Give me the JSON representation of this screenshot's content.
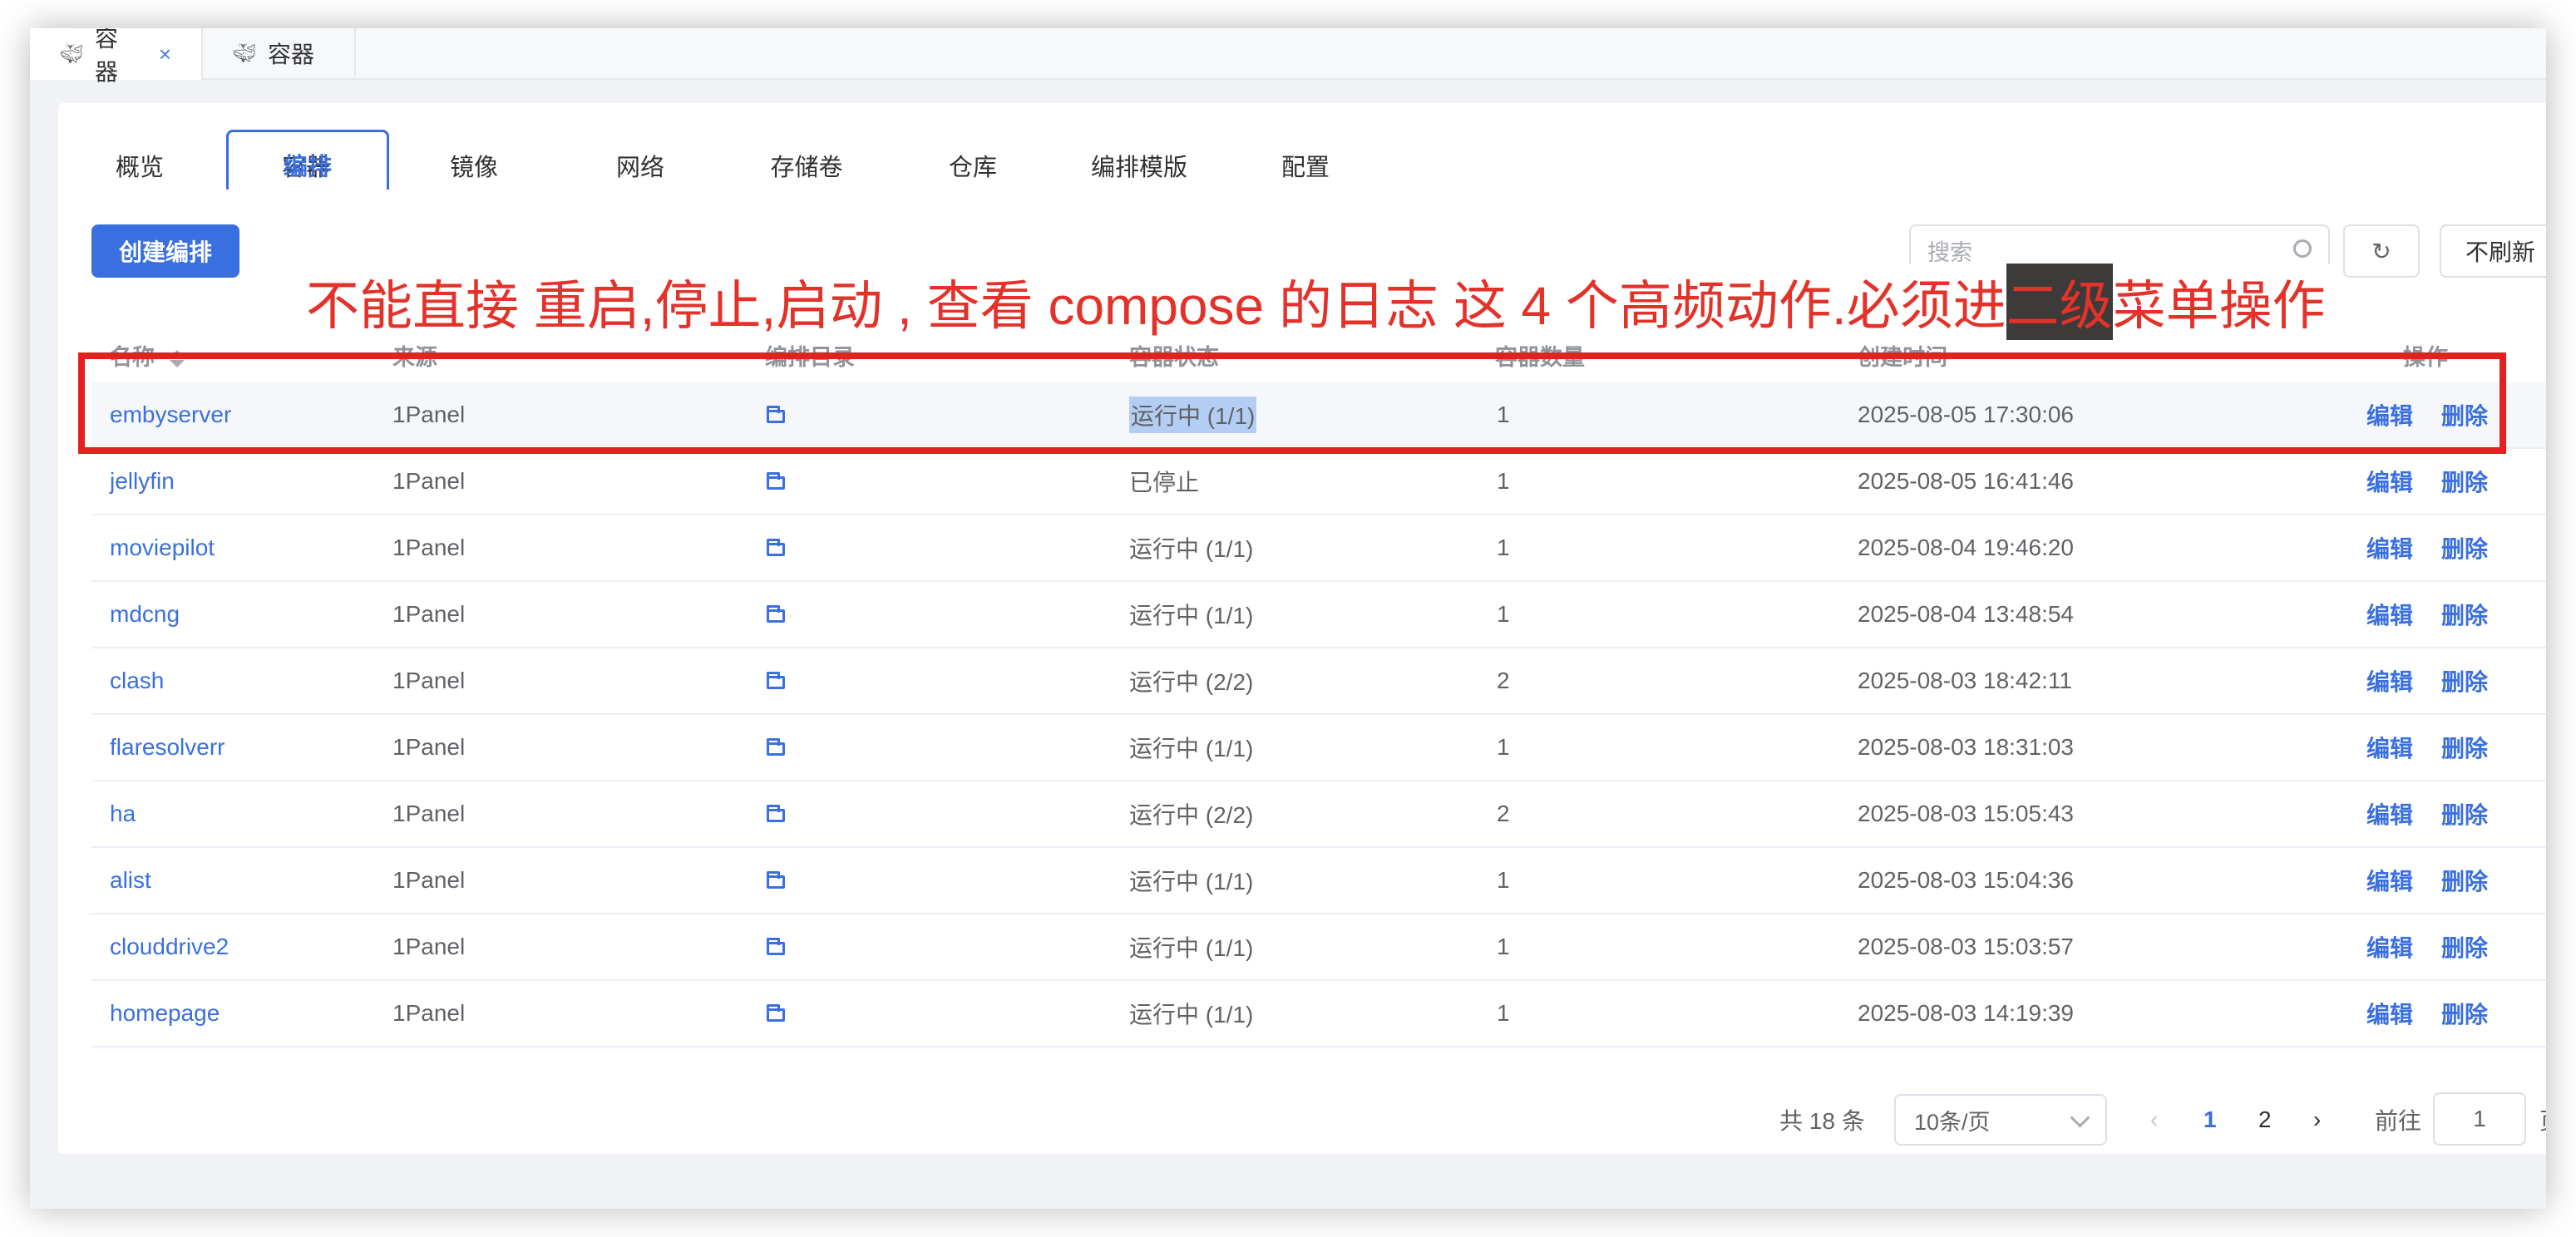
{
  "page_tabs": [
    {
      "icon": "docker-whale-icon",
      "label": "容器",
      "closable": true,
      "active": true
    },
    {
      "icon": "docker-whale-icon",
      "label": "容器",
      "closable": false,
      "active": false
    }
  ],
  "menu_tabs": [
    {
      "label": "概览",
      "active": false
    },
    {
      "label": "容器",
      "active": false
    },
    {
      "label": "编排",
      "active": true
    },
    {
      "label": "镜像",
      "active": false
    },
    {
      "label": "网络",
      "active": false
    },
    {
      "label": "存储卷",
      "active": false
    },
    {
      "label": "仓库",
      "active": false
    },
    {
      "label": "编排模版",
      "active": false
    },
    {
      "label": "配置",
      "active": false
    }
  ],
  "toolbar": {
    "create_label": "创建编排",
    "search_placeholder": "搜索",
    "refresh_icon": "refresh-icon",
    "no_refresh_label": "不刷新"
  },
  "table": {
    "columns": [
      "名称",
      "来源",
      "编排目录",
      "容器状态",
      "容器数量",
      "创建时间",
      "操作"
    ],
    "rows": [
      {
        "name": "embyserver",
        "source": "1Panel",
        "status": "运行中 (1/1)",
        "count": "1",
        "created": "2025-08-05 17:30:06"
      },
      {
        "name": "jellyfin",
        "source": "1Panel",
        "status": "已停止",
        "count": "1",
        "created": "2025-08-05 16:41:46"
      },
      {
        "name": "moviepilot",
        "source": "1Panel",
        "status": "运行中 (1/1)",
        "count": "1",
        "created": "2025-08-04 19:46:20"
      },
      {
        "name": "mdcng",
        "source": "1Panel",
        "status": "运行中 (1/1)",
        "count": "1",
        "created": "2025-08-04 13:48:54"
      },
      {
        "name": "clash",
        "source": "1Panel",
        "status": "运行中 (2/2)",
        "count": "2",
        "created": "2025-08-03 18:42:11"
      },
      {
        "name": "flaresolverr",
        "source": "1Panel",
        "status": "运行中 (1/1)",
        "count": "1",
        "created": "2025-08-03 18:31:03"
      },
      {
        "name": "ha",
        "source": "1Panel",
        "status": "运行中 (2/2)",
        "count": "2",
        "created": "2025-08-03 15:05:43"
      },
      {
        "name": "alist",
        "source": "1Panel",
        "status": "运行中 (1/1)",
        "count": "1",
        "created": "2025-08-03 15:04:36"
      },
      {
        "name": "clouddrive2",
        "source": "1Panel",
        "status": "运行中 (1/1)",
        "count": "1",
        "created": "2025-08-03 15:03:57"
      },
      {
        "name": "homepage",
        "source": "1Panel",
        "status": "运行中 (1/1)",
        "count": "1",
        "created": "2025-08-03 14:19:39"
      }
    ],
    "edit_label": "编辑",
    "delete_label": "删除"
  },
  "pagination": {
    "total": "共 18 条",
    "page_size": "10条/页",
    "pages": [
      "1",
      "2"
    ],
    "current": "1",
    "goto_label": "前往",
    "goto_value": "1",
    "page_suffix": "页"
  },
  "annotation": {
    "before": "不能直接 重启,停止,启动 , 查看 compose 的日志  这 4 个高频动作.必须进",
    "highlight": "二级",
    "after": "菜单操作"
  },
  "colors": {
    "primary": "#3a6fe0",
    "annotation_red": "#e3211e"
  }
}
